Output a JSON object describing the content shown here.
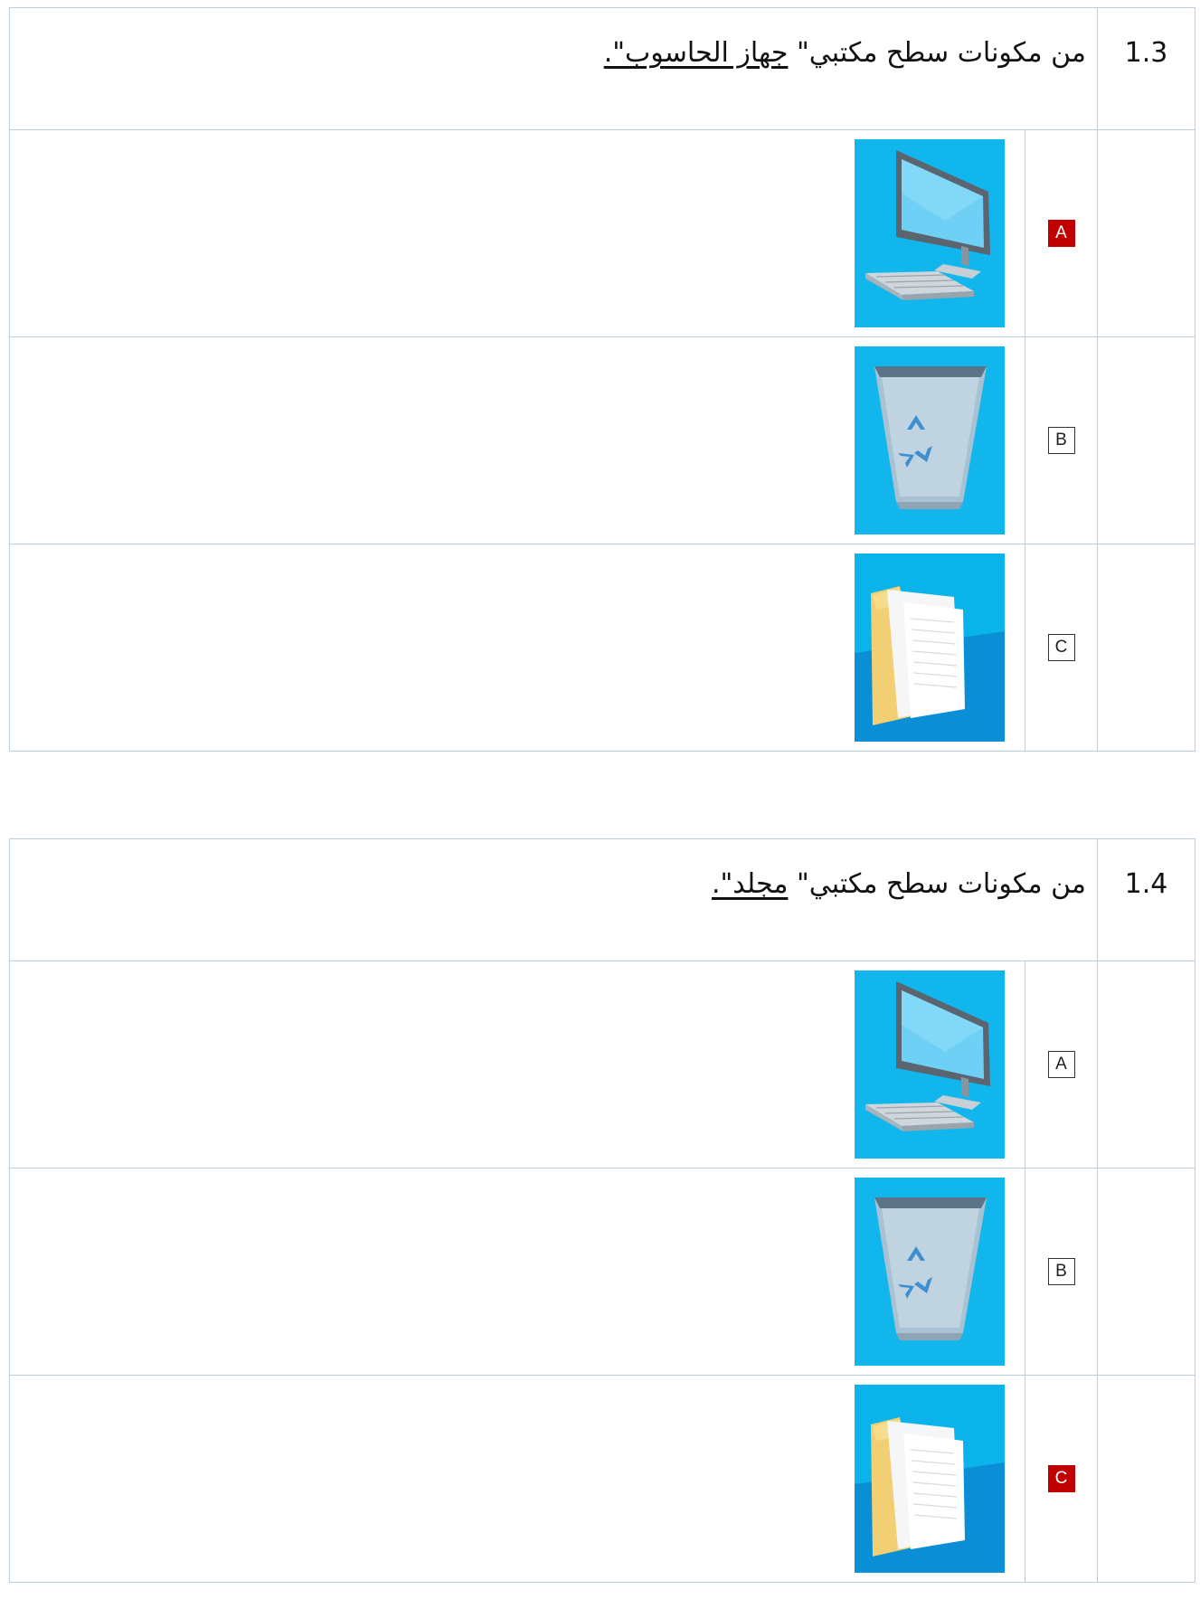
{
  "questions": [
    {
      "number": "1.3",
      "prompt_prefix": "من مكونات سطح مكتبي\" ",
      "prompt_underlined": "جهاز الحاسوب\".",
      "options": [
        {
          "letter": "A",
          "icon": "computer-icon",
          "selected": true
        },
        {
          "letter": "B",
          "icon": "recycle-bin-icon",
          "selected": false
        },
        {
          "letter": "C",
          "icon": "folder-icon",
          "selected": false
        }
      ]
    },
    {
      "number": "1.4",
      "prompt_prefix": "من مكونات سطح مكتبي\" ",
      "prompt_underlined": "مجلد\".",
      "options": [
        {
          "letter": "A",
          "icon": "computer-icon",
          "selected": false
        },
        {
          "letter": "B",
          "icon": "recycle-bin-icon",
          "selected": false
        },
        {
          "letter": "C",
          "icon": "folder-icon",
          "selected": true
        }
      ]
    }
  ],
  "colors": {
    "border": "#b9cde4",
    "selected_badge": "#c00000",
    "icon_background": "#0ab3ea"
  }
}
